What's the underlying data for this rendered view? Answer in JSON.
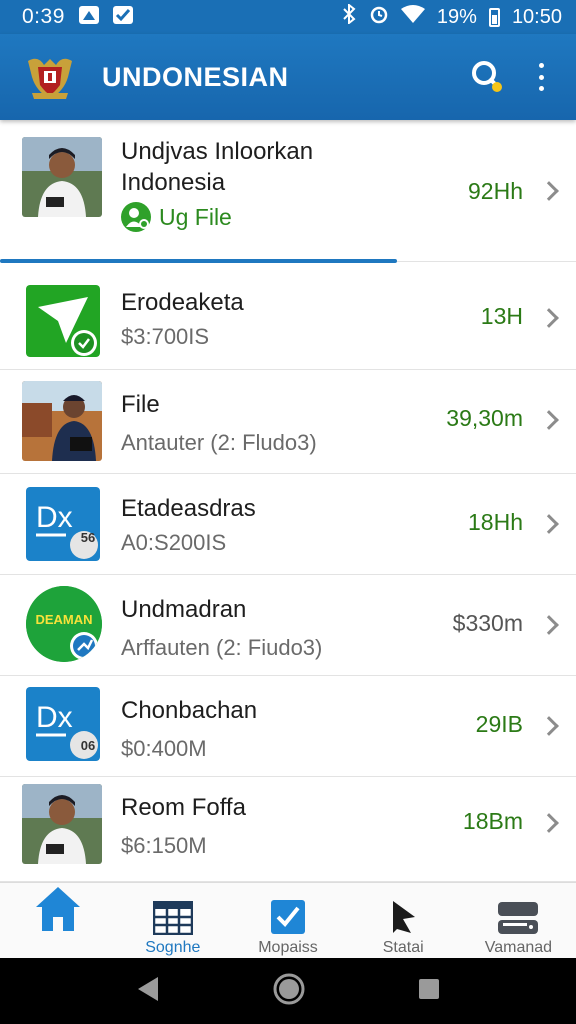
{
  "status_bar": {
    "time": "0:39",
    "battery": "19%",
    "clock_right": "10:50"
  },
  "app_bar": {
    "title": "UNDONESIAN",
    "search_icon": "search-icon",
    "menu_icon": "more-vert-icon"
  },
  "list": {
    "items": [
      {
        "title_line1": "Undjvas Inloorkan",
        "title_line2": "Indonesia",
        "badge": "Ug File",
        "value": "92Hh",
        "thumb": "person-photo"
      },
      {
        "title": "Erodeaketa",
        "subtitle": "$3:700IS",
        "value": "13H",
        "thumb": "green-send-icon"
      },
      {
        "title": "File",
        "subtitle": "Antauter (2: Fludo3)",
        "value": "39,30m",
        "thumb": "person-photo"
      },
      {
        "title": "Etadeasdras",
        "subtitle": "A0:S200IS",
        "value": "18Hh",
        "thumb": "dx-icon",
        "thumb_badge": "56"
      },
      {
        "title": "Undmadran",
        "subtitle": "Arffauten (2: Fiudo3)",
        "value": "$330m",
        "thumb": "deaman-logo",
        "thumb_text": "DEAMAN"
      },
      {
        "title": "Chonbachan",
        "subtitle": "$0:400M",
        "value": "29IB",
        "thumb": "dx-icon",
        "thumb_badge": "06"
      },
      {
        "title": "Reom Foffa",
        "subtitle": "$6:150M",
        "value": "18Bm",
        "thumb": "person-photo"
      }
    ],
    "first_item_progress": 0.69
  },
  "bottom_nav": {
    "items": [
      {
        "label": "",
        "icon": "home-icon"
      },
      {
        "label": "Sognhe",
        "icon": "grid-icon"
      },
      {
        "label": "Mopaiss",
        "icon": "checkbox-icon"
      },
      {
        "label": "Statai",
        "icon": "cursor-icon"
      },
      {
        "label": "Vamanad",
        "icon": "server-icon"
      }
    ]
  },
  "colors": {
    "primary": "#1f78c0",
    "accent_green": "#2b7a16",
    "text_dark": "#1e1e1e",
    "text_grey": "#6a6a6a"
  }
}
